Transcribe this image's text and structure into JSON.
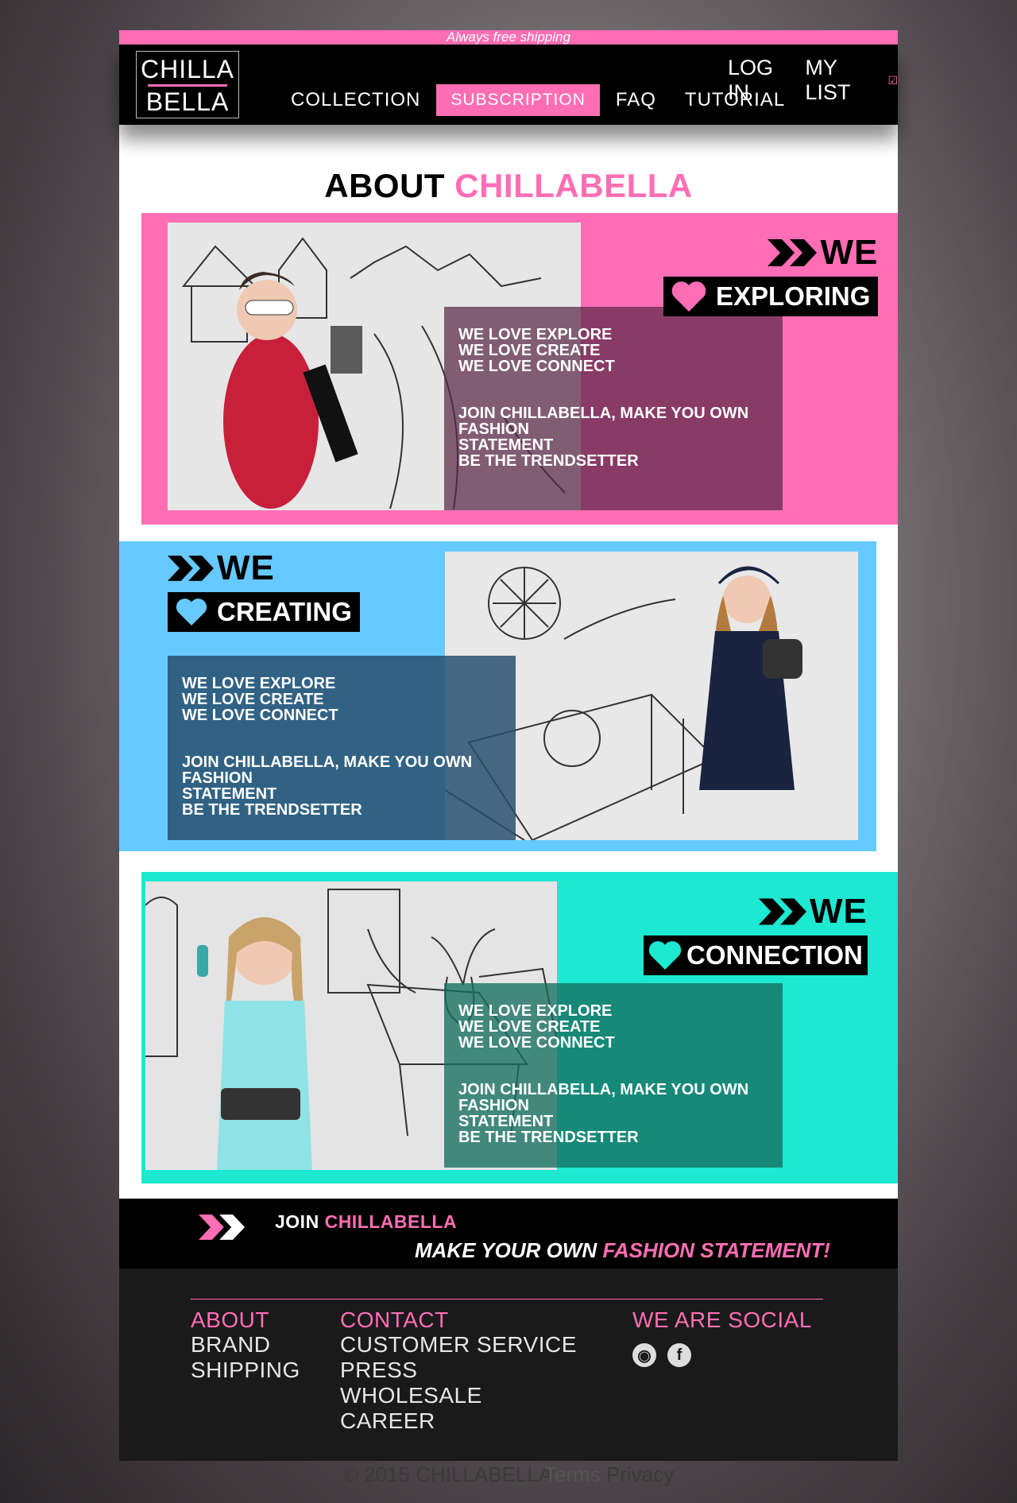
{
  "topbar": {
    "shipping": "Always free shipping"
  },
  "logo": {
    "line1": "CHILLA",
    "line2": "BELLA"
  },
  "nav": {
    "items": [
      {
        "label": "COLLECTION"
      },
      {
        "label": "SUBSCRIPTION"
      },
      {
        "label": "FAQ"
      },
      {
        "label": "TUTORIAL"
      }
    ]
  },
  "utility": {
    "login": "LOG IN",
    "my_list": "MY LIST",
    "check": "☑"
  },
  "about": {
    "title_black": "ABOUT",
    "title_pink": "CHILLABELLA"
  },
  "panels": [
    {
      "we": "WE",
      "tag": "EXPLORING",
      "lines": [
        "WE LOVE EXPLORE",
        "WE LOVE CREATE",
        "WE LOVE CONNECT"
      ],
      "join": [
        "JOIN CHILLABELLA, MAKE YOU OWN FASHION",
        "STATEMENT",
        "BE THE TRENDSETTER"
      ]
    },
    {
      "we": "WE",
      "tag": "CREATING",
      "lines": [
        "WE LOVE EXPLORE",
        "WE LOVE CREATE",
        "WE LOVE CONNECT"
      ],
      "join": [
        "JOIN CHILLABELLA, MAKE YOU OWN FASHION",
        "STATEMENT",
        "BE THE TRENDSETTER"
      ]
    },
    {
      "we": "WE",
      "tag": "CONNECTION",
      "lines": [
        "WE LOVE EXPLORE",
        "WE LOVE CREATE",
        "WE LOVE CONNECT"
      ],
      "join": [
        "JOIN CHILLABELLA, MAKE YOU OWN FASHION",
        "STATEMENT",
        "BE THE TRENDSETTER"
      ]
    }
  ],
  "join_banner": {
    "join": "JOIN",
    "brand": "CHILLABELLA",
    "tag_white": "MAKE YOUR OWN",
    "tag_pink": "FASHION STATEMENT!"
  },
  "footer": {
    "col1": {
      "heading": "ABOUT",
      "links": [
        "BRAND",
        "SHIPPING"
      ]
    },
    "col2": {
      "heading": "CONTACT",
      "links": [
        "CUSTOMER SERVICE",
        "PRESS",
        "WHOLESALE",
        "CAREER"
      ]
    },
    "col3": {
      "heading": "WE ARE SOCIAL",
      "icons": [
        "instagram-icon",
        "facebook-icon"
      ],
      "icon_glyphs": [
        "◉",
        "f"
      ]
    },
    "copyright": "© 2015 CHILLABELLA",
    "terms": "Terms",
    "privacy": "Privacy"
  },
  "colors": {
    "pink": "#ff6eb4",
    "blue": "#66c9ff",
    "teal": "#1de8d2",
    "black": "#000000"
  }
}
